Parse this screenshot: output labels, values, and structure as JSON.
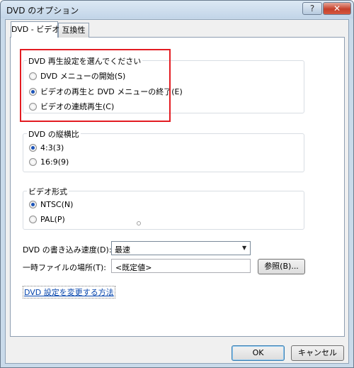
{
  "window": {
    "title": "DVD のオプション",
    "help_label": "?",
    "close_label": "✕"
  },
  "tabs": [
    {
      "label": "DVD - ビデオ",
      "selected": true
    },
    {
      "label": "互換性",
      "selected": false
    }
  ],
  "groups": {
    "playback": {
      "legend": "DVD 再生設定を選んでください",
      "options": [
        {
          "label": "DVD メニューの開始(S)",
          "selected": false
        },
        {
          "label": "ビデオの再生と DVD メニューの終了(E)",
          "selected": true
        },
        {
          "label": "ビデオの連続再生(C)",
          "selected": false
        }
      ]
    },
    "aspect": {
      "legend": "DVD の縦横比",
      "options": [
        {
          "label": "4:3(3)",
          "selected": true
        },
        {
          "label": "16:9(9)",
          "selected": false
        }
      ]
    },
    "video_format": {
      "legend": "ビデオ形式",
      "options": [
        {
          "label": "NTSC(N)",
          "selected": true
        },
        {
          "label": "PAL(P)",
          "selected": false
        }
      ]
    }
  },
  "burn_speed": {
    "label": "DVD の書き込み速度(D):",
    "value": "最速"
  },
  "temp_location": {
    "label": "一時ファイルの場所(T):",
    "value": "<既定値>"
  },
  "browse_label": "参照(B)...",
  "help_link": "DVD 設定を変更する方法",
  "buttons": {
    "ok": "OK",
    "cancel": "キャンセル"
  },
  "colors": {
    "highlight": "#e31c22",
    "link": "#0645ad",
    "titlebar": "#c9daea"
  }
}
